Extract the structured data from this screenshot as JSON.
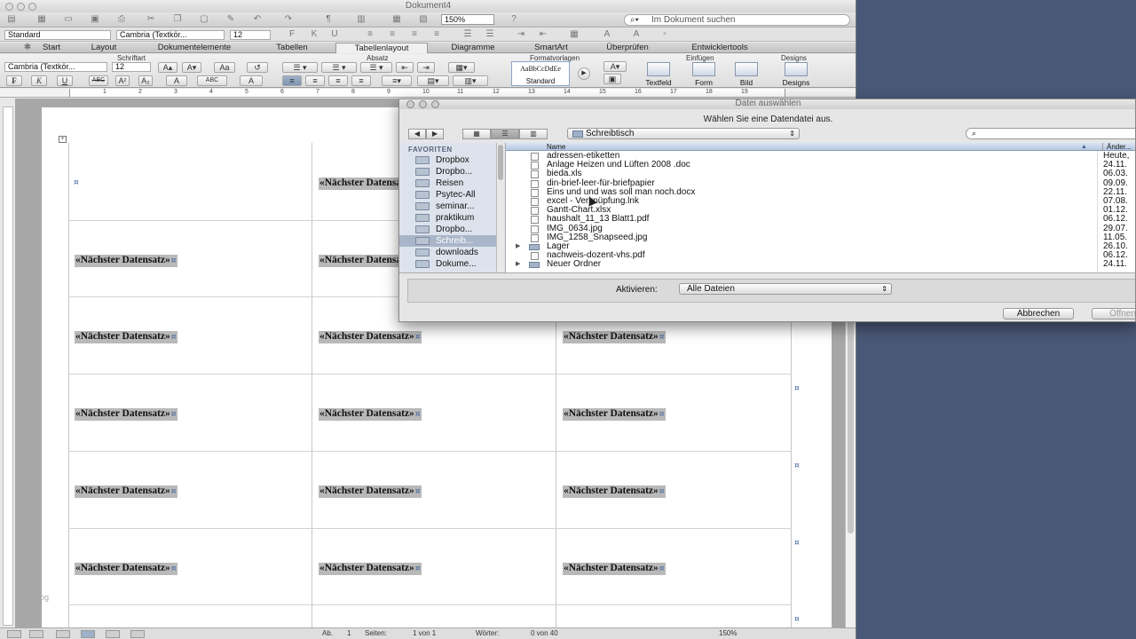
{
  "app": {
    "doc_title": "Dokument4",
    "zoom": "150%",
    "search_placeholder": "Im Dokument suchen"
  },
  "format_bar": {
    "style": "Standard",
    "font": "Cambria (Textkör...",
    "size": "12"
  },
  "ribbon_tabs": [
    "Start",
    "Layout",
    "Dokumentelemente",
    "Tabellen",
    "Tabellenlayout",
    "Diagramme",
    "SmartArt",
    "Überprüfen",
    "Entwicklertools"
  ],
  "ribbon_active_tab": "Tabellenlayout",
  "ribbon": {
    "group_schriftart": "Schriftart",
    "group_absatz": "Absatz",
    "group_formatvorlagen": "Formatvorlagen",
    "group_einfuegen": "Einfügen",
    "group_designs": "Designs",
    "font": "Cambria (Textkör...",
    "size": "12",
    "style_preview": "AaBbCcDdEe",
    "style_name": "Standard",
    "textfeld": "Textfeld",
    "form": "Form",
    "bild": "Bild",
    "designs": "Designs",
    "bold": "F",
    "italic": "K",
    "underline": "U",
    "strike": "ABC"
  },
  "ruler_numbers": [
    "1",
    "2",
    "3",
    "4",
    "5",
    "6",
    "7",
    "8",
    "9",
    "10",
    "11",
    "12",
    "13",
    "14",
    "15",
    "16",
    "17",
    "18",
    "19"
  ],
  "document": {
    "merge_field": "«Nächster Datensatz»"
  },
  "dialog": {
    "title": "Datei auswählen",
    "prompt": "Wählen Sie eine Datendatei aus.",
    "location": "Schreibtisch",
    "sidebar_heading": "FAVORITEN",
    "sidebar_items": [
      "Dropbox",
      "Dropbo...",
      "Reisen",
      "Psytec-All",
      "seminar...",
      "praktikum",
      "Dropbo...",
      "Schreib...",
      "downloads",
      "Dokume..."
    ],
    "selected_sidebar": "Schreib...",
    "col_name": "Name",
    "col_date": "Änder...",
    "files": [
      {
        "name": "adressen-etiketten",
        "date": "Heute,",
        "kind": "doc"
      },
      {
        "name": "Anlage Heizen und Lüften 2008 .doc",
        "date": "24.11.",
        "kind": "doc"
      },
      {
        "name": "bieda.xls",
        "date": "06.03.",
        "kind": "doc"
      },
      {
        "name": "din-brief-leer-für-briefpapier",
        "date": "09.09.",
        "kind": "doc"
      },
      {
        "name": "Eins und und was soll man noch.docx",
        "date": "22.11.",
        "kind": "doc"
      },
      {
        "name": "excel - Verknüpfung.lnk",
        "date": "07.08.",
        "kind": "doc"
      },
      {
        "name": "Gantt-Chart.xlsx",
        "date": "01.12.",
        "kind": "doc"
      },
      {
        "name": "haushalt_11_13 Blatt1.pdf",
        "date": "06.12.",
        "kind": "doc"
      },
      {
        "name": "IMG_0634.jpg",
        "date": "29.07.",
        "kind": "doc"
      },
      {
        "name": "IMG_1258_Snapseed.jpg",
        "date": "11.05.",
        "kind": "doc"
      },
      {
        "name": "Lager",
        "date": "26.10.",
        "kind": "folder"
      },
      {
        "name": "nachweis-dozent-vhs.pdf",
        "date": "06.12.",
        "kind": "doc"
      },
      {
        "name": "Neuer Ordner",
        "date": "24.11.",
        "kind": "folder"
      }
    ],
    "enable_label": "Aktivieren:",
    "enable_value": "Alle Dateien",
    "cancel": "Abbrechen",
    "open": "Öffnen"
  },
  "status": {
    "ab": "Ab.",
    "ab_val": "1",
    "seiten": "Seiten:",
    "seiten_val": "1 von 1",
    "woerter": "Wörter:",
    "woerter_val": "0 von 40",
    "zoom": "150%"
  },
  "watermark": "blog"
}
